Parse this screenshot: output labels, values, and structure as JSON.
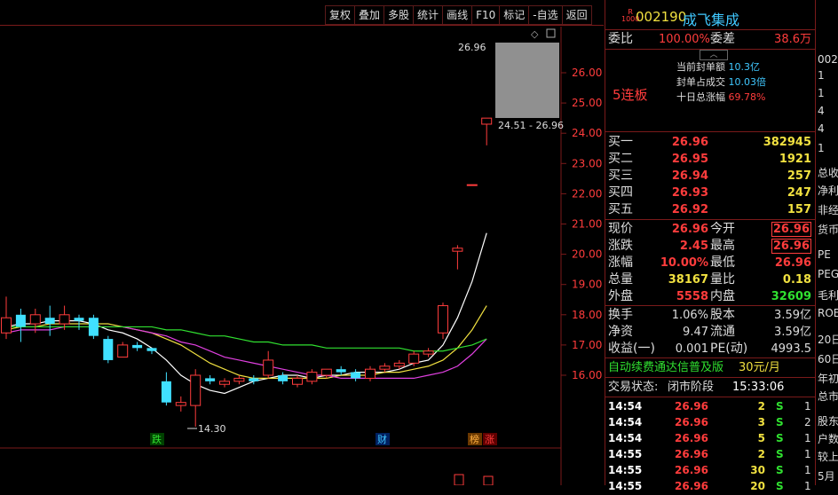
{
  "toolbar": {
    "buttons": [
      "复权",
      "叠加",
      "多股",
      "统计",
      "画线",
      "F10",
      "标记",
      "-自选",
      "返回"
    ]
  },
  "chart": {
    "y_ticks": [
      "26.00",
      "25.00",
      "24.00",
      "23.00",
      "22.00",
      "21.00",
      "20.00",
      "19.00",
      "18.00",
      "17.00",
      "16.00"
    ],
    "high_label": "26.96",
    "range_label": "24.51 - 26.96",
    "low_label": "14.30",
    "markers": {
      "die": "跌",
      "cai": "财",
      "bang": "榜",
      "zhang": "涨"
    }
  },
  "chart_data": {
    "type": "candlestick",
    "candles": [
      {
        "o": 17.4,
        "c": 17.9,
        "h": 18.6,
        "l": 17.2
      },
      {
        "o": 18.0,
        "c": 17.6,
        "h": 18.2,
        "l": 17.1
      },
      {
        "o": 17.7,
        "c": 18.0,
        "h": 18.2,
        "l": 17.4
      },
      {
        "o": 17.9,
        "c": 17.7,
        "h": 18.3,
        "l": 17.3
      },
      {
        "o": 17.7,
        "c": 18.0,
        "h": 18.3,
        "l": 17.5
      },
      {
        "o": 17.9,
        "c": 17.8,
        "h": 18.0,
        "l": 17.5
      },
      {
        "o": 17.9,
        "c": 17.3,
        "h": 18.0,
        "l": 17.2
      },
      {
        "o": 17.2,
        "c": 16.5,
        "h": 17.3,
        "l": 16.4
      },
      {
        "o": 16.6,
        "c": 17.0,
        "h": 17.1,
        "l": 16.6
      },
      {
        "o": 17.0,
        "c": 16.9,
        "h": 17.1,
        "l": 16.8
      },
      {
        "o": 16.9,
        "c": 16.8,
        "h": 16.9,
        "l": 16.7
      },
      {
        "o": 15.8,
        "c": 15.1,
        "h": 16.1,
        "l": 15.0
      },
      {
        "o": 15.0,
        "c": 15.1,
        "h": 15.3,
        "l": 14.8
      },
      {
        "o": 15.0,
        "c": 16.0,
        "h": 16.2,
        "l": 14.3
      },
      {
        "o": 15.9,
        "c": 15.8,
        "h": 16.0,
        "l": 15.7
      },
      {
        "o": 15.7,
        "c": 15.8,
        "h": 15.9,
        "l": 15.6
      },
      {
        "o": 15.8,
        "c": 15.9,
        "h": 16.0,
        "l": 15.7
      },
      {
        "o": 15.9,
        "c": 15.8,
        "h": 16.0,
        "l": 15.7
      },
      {
        "o": 16.0,
        "c": 16.5,
        "h": 16.8,
        "l": 15.9
      },
      {
        "o": 16.0,
        "c": 15.8,
        "h": 16.1,
        "l": 15.7
      },
      {
        "o": 15.7,
        "c": 15.9,
        "h": 16.0,
        "l": 15.6
      },
      {
        "o": 15.8,
        "c": 16.1,
        "h": 16.2,
        "l": 15.7
      },
      {
        "o": 16.0,
        "c": 16.2,
        "h": 16.2,
        "l": 15.9
      },
      {
        "o": 16.2,
        "c": 16.1,
        "h": 16.3,
        "l": 16.0
      },
      {
        "o": 16.1,
        "c": 15.9,
        "h": 16.2,
        "l": 15.8
      },
      {
        "o": 15.9,
        "c": 16.2,
        "h": 16.3,
        "l": 15.8
      },
      {
        "o": 16.2,
        "c": 16.3,
        "h": 16.4,
        "l": 16.1
      },
      {
        "o": 16.3,
        "c": 16.4,
        "h": 16.5,
        "l": 16.2
      },
      {
        "o": 16.4,
        "c": 16.7,
        "h": 16.8,
        "l": 16.3
      },
      {
        "o": 16.7,
        "c": 16.8,
        "h": 16.9,
        "l": 16.6
      },
      {
        "o": 17.4,
        "c": 18.3,
        "h": 18.4,
        "l": 17.2
      },
      {
        "o": 20.1,
        "c": 20.2,
        "h": 20.3,
        "l": 19.5
      },
      {
        "o": 22.3,
        "c": 22.3,
        "h": 22.3,
        "l": 22.3
      },
      {
        "o": 24.3,
        "c": 24.5,
        "h": 24.5,
        "l": 23.6
      }
    ],
    "ma": [
      {
        "name": "MA5",
        "color": "#ffffff",
        "values": [
          17.6,
          17.7,
          17.7,
          17.8,
          17.8,
          17.8,
          17.7,
          17.5,
          17.4,
          17.2,
          16.9,
          16.5,
          16.0,
          15.7,
          15.5,
          15.4,
          15.6,
          15.8,
          15.9,
          16.0,
          16.0,
          15.9,
          16.0,
          16.0,
          16.1,
          16.1,
          16.1,
          16.2,
          16.4,
          16.5,
          17.0,
          17.9,
          19.1,
          20.7
        ]
      },
      {
        "name": "MA10",
        "color": "#f0e040",
        "values": [
          17.5,
          17.6,
          17.6,
          17.7,
          17.7,
          17.7,
          17.7,
          17.7,
          17.6,
          17.5,
          17.4,
          17.2,
          17.0,
          16.7,
          16.4,
          16.2,
          16.0,
          15.9,
          15.9,
          15.9,
          15.9,
          15.9,
          15.9,
          16.0,
          16.0,
          16.0,
          16.1,
          16.1,
          16.2,
          16.3,
          16.5,
          16.9,
          17.5,
          18.3
        ]
      },
      {
        "name": "MA20",
        "color": "#e040e0",
        "values": [
          17.4,
          17.5,
          17.5,
          17.5,
          17.6,
          17.6,
          17.6,
          17.6,
          17.6,
          17.5,
          17.4,
          17.3,
          17.1,
          17.0,
          16.8,
          16.6,
          16.5,
          16.4,
          16.3,
          16.2,
          16.1,
          16.0,
          16.0,
          15.9,
          15.9,
          15.9,
          15.9,
          15.9,
          15.9,
          16.0,
          16.1,
          16.3,
          16.7,
          17.2
        ]
      },
      {
        "name": "MA60",
        "color": "#30e030",
        "values": [
          17.6,
          17.6,
          17.6,
          17.6,
          17.6,
          17.6,
          17.6,
          17.6,
          17.6,
          17.6,
          17.6,
          17.5,
          17.5,
          17.4,
          17.3,
          17.3,
          17.2,
          17.1,
          17.1,
          17.0,
          17.0,
          17.0,
          16.9,
          16.9,
          16.9,
          16.9,
          16.9,
          16.9,
          16.8,
          16.8,
          16.8,
          16.9,
          17.0,
          17.2
        ]
      }
    ],
    "ylim": [
      15.0,
      27.0
    ]
  },
  "panel": {
    "stock_icon_top": "R",
    "stock_icon_bottom": "1000",
    "stock_code": "002190",
    "stock_name": "成飞集成",
    "weibi_label": "委比",
    "weibi_value": "100.00%",
    "weicha_label": "委差",
    "weicha_value": "38.6万",
    "lianban": "5连板",
    "info": [
      {
        "label": "当前封单额",
        "value": "10.3亿"
      },
      {
        "label": "封单占成交",
        "value": "10.03倍"
      },
      {
        "label": "十日总涨幅",
        "value": "69.78%"
      }
    ],
    "bids": [
      {
        "label": "买一",
        "price": "26.96",
        "vol": "382945"
      },
      {
        "label": "买二",
        "price": "26.95",
        "vol": "1921"
      },
      {
        "label": "买三",
        "price": "26.94",
        "vol": "257"
      },
      {
        "label": "买四",
        "price": "26.93",
        "vol": "247"
      },
      {
        "label": "买五",
        "price": "26.92",
        "vol": "157"
      }
    ],
    "quote_rows": [
      {
        "l1": "现价",
        "v1": "26.96",
        "l2": "今开",
        "v2": "26.96",
        "c1": "red",
        "c2": "red",
        "box": true
      },
      {
        "l1": "涨跌",
        "v1": "2.45",
        "l2": "最高",
        "v2": "26.96",
        "c1": "red",
        "c2": "red",
        "box": true
      },
      {
        "l1": "涨幅",
        "v1": "10.00%",
        "l2": "最低",
        "v2": "26.96",
        "c1": "red",
        "c2": "red",
        "box": false
      },
      {
        "l1": "总量",
        "v1": "38167",
        "l2": "量比",
        "v2": "0.18",
        "c1": "yel",
        "c2": "yel",
        "box": false
      },
      {
        "l1": "外盘",
        "v1": "5558",
        "l2": "内盘",
        "v2": "32609",
        "c1": "red",
        "c2": "grn",
        "box": false
      }
    ],
    "stat_rows": [
      {
        "l1": "换手",
        "v1": "1.06%",
        "l2": "股本",
        "v2": "3.59亿"
      },
      {
        "l1": "净资",
        "v1": "9.47",
        "l2": "流通",
        "v2": "3.59亿"
      },
      {
        "l1": "收益(一)",
        "v1": "0.001",
        "l2": "PE(动)",
        "v2": "4993.5"
      }
    ],
    "ad_text": "自动续费通达信普及版",
    "ad_price": "30元/月",
    "trade_status_label": "交易状态:",
    "trade_status_value": "闭市阶段",
    "trade_time": "15:33:06",
    "ticks": [
      {
        "time": "14:54",
        "price": "26.96",
        "vol": "2",
        "dir": "S",
        "n": "1"
      },
      {
        "time": "14:54",
        "price": "26.96",
        "vol": "3",
        "dir": "S",
        "n": "2"
      },
      {
        "time": "14:54",
        "price": "26.96",
        "vol": "5",
        "dir": "S",
        "n": "1"
      },
      {
        "time": "14:55",
        "price": "26.96",
        "vol": "2",
        "dir": "S",
        "n": "1"
      },
      {
        "time": "14:55",
        "price": "26.96",
        "vol": "30",
        "dir": "S",
        "n": "1"
      },
      {
        "time": "14:55",
        "price": "26.96",
        "vol": "20",
        "dir": "S",
        "n": "1"
      }
    ]
  },
  "strip": {
    "items": [
      "002",
      "1",
      "1",
      "4",
      "4",
      "1",
      "总收",
      "净利",
      "非经",
      "货币",
      "PE",
      "PEG",
      "毛利",
      "ROE",
      "20日",
      "60日",
      "年初",
      "总市",
      "股东",
      "户数",
      "较上",
      "5月"
    ]
  }
}
